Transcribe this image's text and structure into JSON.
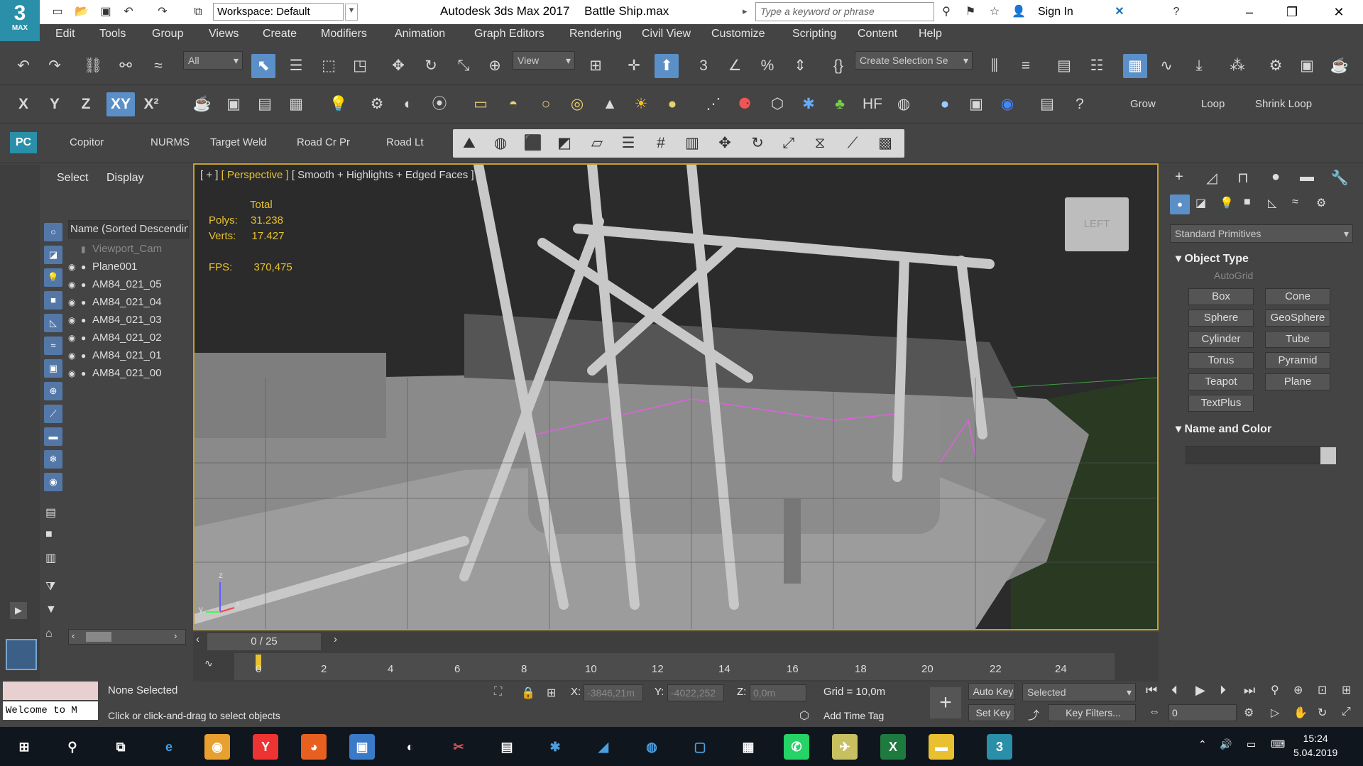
{
  "app": {
    "logo_text": "3",
    "logo_sub": "MAX",
    "title": "Autodesk 3ds Max 2017",
    "file": "Battle Ship.max"
  },
  "workspace": {
    "label": "Workspace: Default"
  },
  "search": {
    "placeholder": "Type a keyword or phrase"
  },
  "account": {
    "signin": "Sign In"
  },
  "menu": [
    "Edit",
    "Tools",
    "Group",
    "Views",
    "Create",
    "Modifiers",
    "Animation",
    "Graph Editors",
    "Rendering",
    "Civil View",
    "Customize",
    "Scripting",
    "Content",
    "Help"
  ],
  "toolbar1": {
    "selection_filter": "All",
    "ref_coord": "View",
    "named_sel": "Create Selection Se"
  },
  "toolbar2": {
    "axis_x": "X",
    "axis_y": "Y",
    "axis_z": "Z",
    "axis_xy": "XY",
    "axis_xyp": "X²",
    "grow": "Grow",
    "loop": "Loop",
    "shrink_loop": "Shrink Loop"
  },
  "ribbon": {
    "pc": "PC",
    "items": [
      "Copitor",
      "NURMS",
      "Target Weld",
      "Road Cr Pr",
      "Road Lt"
    ]
  },
  "scene_explorer": {
    "tabs": [
      "Select",
      "Display"
    ],
    "header": "Name (Sorted Descendin",
    "rows": [
      "Viewport_Cam",
      "Plane001",
      "AM84_021_05",
      "AM84_021_04",
      "AM84_021_03",
      "AM84_021_02",
      "AM84_021_01",
      "AM84_021_00"
    ]
  },
  "viewport": {
    "label_plus": "[ + ]",
    "label_view": "[ Perspective ]",
    "label_shading": "[ Smooth + Highlights + Edged Faces ]",
    "stats_total": "Total",
    "polys_label": "Polys:",
    "polys_value": "31.238",
    "verts_label": "Verts:",
    "verts_value": "17.427",
    "fps_label": "FPS:",
    "fps_value": "370,475",
    "viewcube_text": "LEFT",
    "axis_z": "z",
    "axis_x": "x",
    "axis_y": "y"
  },
  "command_panel": {
    "category": "Standard Primitives",
    "object_type": "Object Type",
    "autogrid": "AutoGrid",
    "primitives": [
      "Box",
      "Cone",
      "Sphere",
      "GeoSphere",
      "Cylinder",
      "Tube",
      "Torus",
      "Pyramid",
      "Teapot",
      "Plane",
      "TextPlus"
    ],
    "name_color": "Name and Color"
  },
  "timeline": {
    "frame": "0 / 25",
    "ticks": [
      "0",
      "2",
      "4",
      "6",
      "8",
      "10",
      "12",
      "14",
      "16",
      "18",
      "20",
      "22",
      "24"
    ]
  },
  "status": {
    "selection": "None Selected",
    "prompt": "Click or click-and-drag to select objects",
    "welcome": "Welcome to M",
    "x_label": "X:",
    "x_value": "-3846,21m",
    "y_label": "Y:",
    "y_value": "-4022,252",
    "z_label": "Z:",
    "z_value": "0,0m",
    "grid": "Grid = 10,0m",
    "add_time_tag": "Add Time Tag",
    "auto_key": "Auto Key",
    "selected": "Selected",
    "set_key": "Set Key",
    "key_filters": "Key Filters...",
    "frame_field": "0"
  },
  "taskbar": {
    "time": "15:24",
    "date": "5.04.2019"
  },
  "colors": {
    "accent": "#5b8fc8",
    "viewport_border": "#c8a02a",
    "stats": "#e8c230",
    "logo": "#2a8fa8"
  }
}
